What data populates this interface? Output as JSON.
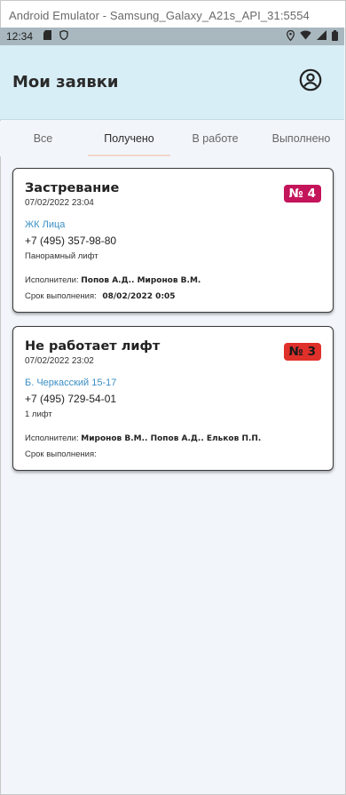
{
  "window": {
    "title": "Android Emulator - Samsung_Galaxy_A21s_API_31:5554"
  },
  "status_bar": {
    "time": "12:34",
    "left_icons": [
      "sd-card-icon",
      "shield-icon"
    ],
    "right_icons": [
      "location-icon",
      "wifi-icon",
      "signal-icon",
      "battery-icon"
    ]
  },
  "header": {
    "title": "Мои заявки",
    "profile_icon": "account-circle-icon"
  },
  "tabs": [
    {
      "label": "Все",
      "active": false
    },
    {
      "label": "Получено",
      "active": true
    },
    {
      "label": "В работе",
      "active": false
    },
    {
      "label": "Выполнено",
      "active": false
    }
  ],
  "requests": [
    {
      "title": "Застревание",
      "date": "07/02/2022 23:04",
      "number": "№ 4",
      "badge_color": "#c4145a",
      "address": "ЖК Лица",
      "phone": "+7 (495) 357-98-80",
      "lift": "Панорамный лифт",
      "executors_label": "Исполнители:",
      "executors": "Попов А.Д.. Миронов В.М.",
      "deadline_label": "Срок выполнения:",
      "deadline": "08/02/2022 0:05"
    },
    {
      "title": "Не работает лифт",
      "date": "07/02/2022 23:02",
      "number": "№ 3",
      "badge_color": "#e0302a",
      "address": "Б. Черкасский 15-17",
      "phone": "+7 (495) 729-54-01",
      "lift": "1 лифт",
      "executors_label": "Исполнители:",
      "executors": "Миронов В.М.. Попов А.Д.. Ельков П.П.",
      "deadline_label": "Срок выполнения:",
      "deadline": ""
    }
  ]
}
